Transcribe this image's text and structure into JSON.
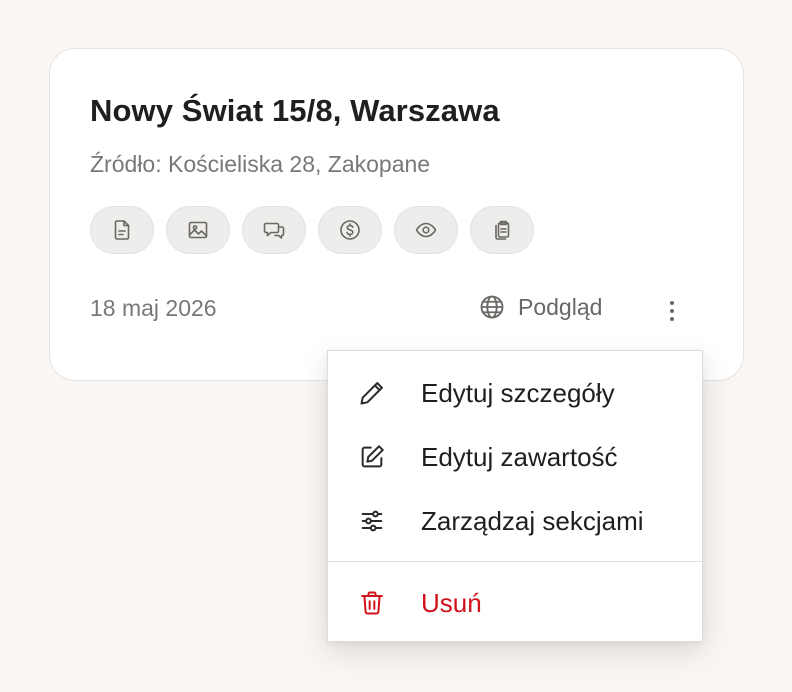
{
  "card": {
    "title": "Nowy Świat 15/8, Warszawa",
    "source": "Źródło: Kościeliska 28, Zakopane",
    "date": "18 maj 2026",
    "preview_label": "Podgląd",
    "icons": [
      "document-icon",
      "image-icon",
      "chat-icon",
      "dollar-icon",
      "eye-icon",
      "clipboard-icon"
    ]
  },
  "menu": {
    "items": [
      {
        "label": "Edytuj szczegóły",
        "icon": "pencil-icon"
      },
      {
        "label": "Edytuj zawartość",
        "icon": "edit-square-icon"
      },
      {
        "label": "Zarządzaj sekcjami",
        "icon": "sliders-icon"
      },
      {
        "label": "Usuń",
        "icon": "trash-icon"
      }
    ]
  },
  "colors": {
    "background": "#f9f6f4",
    "danger": "#d0101a",
    "muted_text": "#7a7875"
  }
}
